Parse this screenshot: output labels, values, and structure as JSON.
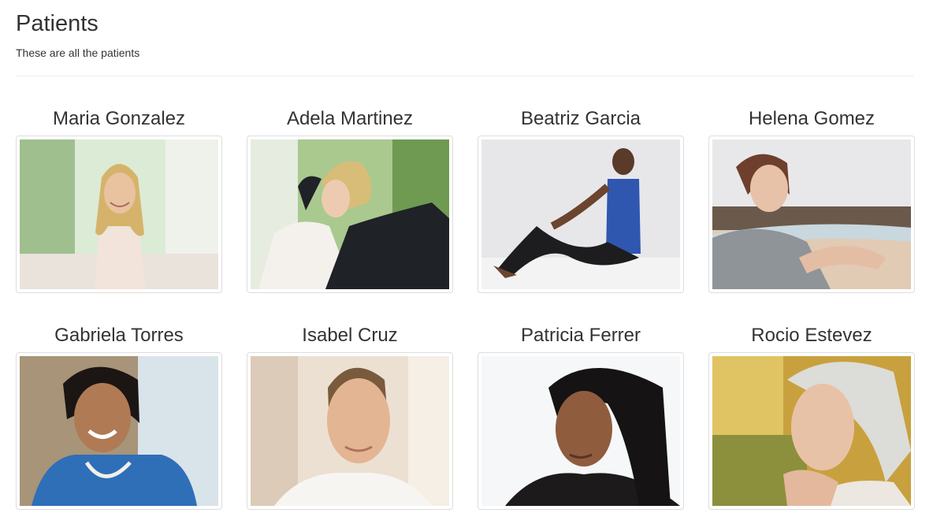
{
  "header": {
    "title": "Patients",
    "subtitle": "These are all the patients"
  },
  "patients": [
    {
      "name": "Maria Gonzalez",
      "photo": "portrait-smiling-blonde-woman"
    },
    {
      "name": "Adela Martinez",
      "photo": "portrait-relaxing-woman-hands-behind-head"
    },
    {
      "name": "Beatriz Garcia",
      "photo": "portrait-woman-sitting-on-floor"
    },
    {
      "name": "Helena Gomez",
      "photo": "portrait-woman-stretching-at-beach"
    },
    {
      "name": "Gabriela Torres",
      "photo": "portrait-laughing-woman-in-blue"
    },
    {
      "name": "Isabel Cruz",
      "photo": "portrait-woman-white-shirt"
    },
    {
      "name": "Patricia Ferrer",
      "photo": "portrait-woman-looking-away"
    },
    {
      "name": "Rocio Estevez",
      "photo": "portrait-elderly-woman-outdoors"
    }
  ],
  "colors": {
    "text": "#333333",
    "divider": "#eeeeee",
    "thumbnail_border": "#dddddd"
  }
}
